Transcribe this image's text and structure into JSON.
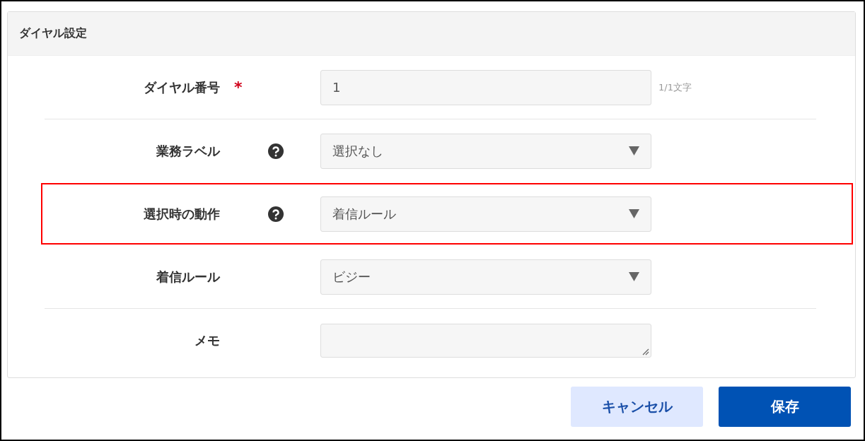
{
  "panel": {
    "title": "ダイヤル設定",
    "groups": [
      {
        "rows": [
          {
            "label": "ダイヤル番号",
            "required_mark": "*",
            "help": false,
            "highlighted": false,
            "kind": "text",
            "value": "1",
            "counter": "1/1文字"
          }
        ]
      },
      {
        "rows": [
          {
            "label": "業務ラベル",
            "help": true,
            "highlighted": false,
            "kind": "select",
            "value": "選択なし"
          },
          {
            "label": "選択時の動作",
            "help": true,
            "highlighted": true,
            "kind": "select",
            "value": "着信ルール"
          },
          {
            "label": "着信ルール",
            "help": false,
            "highlighted": false,
            "kind": "select",
            "value": "ビジー"
          }
        ]
      },
      {
        "rows": [
          {
            "label": "メモ",
            "help": false,
            "highlighted": false,
            "kind": "textarea"
          }
        ]
      }
    ]
  },
  "buttons": [
    {
      "label": "キャンセル",
      "kind": "secondary"
    },
    {
      "label": "保存",
      "kind": "primary"
    }
  ]
}
